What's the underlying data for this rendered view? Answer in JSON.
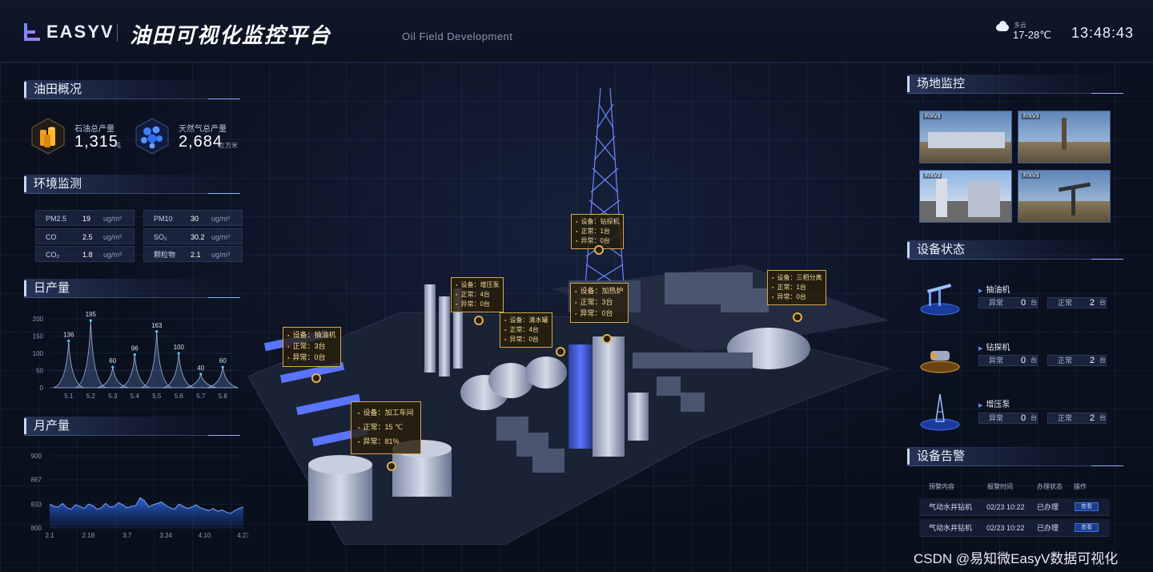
{
  "header": {
    "logo_text": "EASYV",
    "title": "油田可视化监控平台",
    "subtitle": "Oil Field Development",
    "weather_desc": "多云",
    "weather_temp": "17-28℃",
    "time": "13:48:43"
  },
  "overview": {
    "title": "油田概况",
    "oil_label": "石油总产量",
    "oil_value": "1,315",
    "oil_unit": "吨",
    "gas_label": "天然气总产量",
    "gas_value": "2,684",
    "gas_unit": "立方米"
  },
  "environment": {
    "title": "环境监测",
    "cells": [
      {
        "name": "PM2.5",
        "value": "19",
        "unit": "ug/m³"
      },
      {
        "name": "PM10",
        "value": "30",
        "unit": "ug/m³"
      },
      {
        "name": "CO",
        "value": "2.5",
        "unit": "ug/m³"
      },
      {
        "name": "SO₂",
        "value": "30.2",
        "unit": "ug/m³"
      },
      {
        "name": "CO₂",
        "value": "1.8",
        "unit": "ug/m³"
      },
      {
        "name": "颗粒物",
        "value": "2.1",
        "unit": "ug/m³"
      }
    ]
  },
  "daily": {
    "title": "日产量"
  },
  "monthly": {
    "title": "月产量"
  },
  "chart_data": [
    {
      "type": "area",
      "categories": [
        "5.1",
        "5.2",
        "5.3",
        "5.4",
        "5.5",
        "5.6",
        "5.7",
        "5.8"
      ],
      "values": [
        136,
        195,
        60,
        96,
        163,
        100,
        40,
        60
      ],
      "yticks": [
        "0",
        "50",
        "100",
        "150",
        "200"
      ],
      "ylim": [
        0,
        200
      ]
    },
    {
      "type": "area",
      "xticks": [
        "2.1",
        "2.18",
        "3.7",
        "3.24",
        "4.10",
        "4.27"
      ],
      "yticks": [
        "800",
        "833",
        "867",
        "900"
      ],
      "ylim": [
        800,
        900
      ],
      "values": [
        833,
        830,
        829,
        834,
        828,
        826,
        832,
        830,
        827,
        833,
        831,
        826,
        828,
        834,
        829,
        830,
        835,
        832,
        828,
        830,
        831,
        842,
        838,
        829,
        832,
        834,
        836,
        831,
        828,
        826,
        833,
        830,
        827,
        829,
        832,
        828,
        826,
        824,
        827,
        823,
        825,
        822,
        820,
        824,
        827,
        829
      ]
    }
  ],
  "site": {
    "title": "场地监控",
    "cameras": [
      {
        "tag": "F/XV3"
      },
      {
        "tag": "F/XV3"
      },
      {
        "tag": "F/XV3"
      },
      {
        "tag": "F/XV3"
      }
    ]
  },
  "equipment": {
    "title": "设备状态",
    "abnormal_label": "异常",
    "normal_label": "正常",
    "unit": "台",
    "items": [
      {
        "name": "抽油机",
        "abnormal": "0",
        "normal": "2"
      },
      {
        "name": "钻探机",
        "abnormal": "0",
        "normal": "2"
      },
      {
        "name": "增压泵",
        "abnormal": "0",
        "normal": "2"
      }
    ]
  },
  "alarms": {
    "title": "设备告警",
    "headers": [
      "预警内容",
      "报警时间",
      "办理状态",
      "操作"
    ],
    "rows": [
      {
        "content": "气动水井钻机",
        "time": "02/23 10:22",
        "status": "已办理",
        "action": "查看"
      },
      {
        "content": "气动水井钻机",
        "time": "02/23 10:22",
        "status": "已办理",
        "action": "查看"
      }
    ]
  },
  "scene_labels": {
    "drill": [
      "设备：钻探机",
      "正常：1台",
      "异常：0台"
    ],
    "pump": [
      "设备：增压泵",
      "正常：4台",
      "异常：0台"
    ],
    "tank": [
      "设备：清水罐",
      "正常：4台",
      "异常：0台"
    ],
    "heater": [
      "设备：加热炉",
      "正常：3台",
      "异常：0台"
    ],
    "separator": [
      "设备：三相分离",
      "正常：1台",
      "异常：0台"
    ],
    "pumpjack": [
      "设备：抽油机",
      "正常：3台",
      "异常：0台"
    ],
    "workshop": [
      "设备：加工车间",
      "正常：15 ℃",
      "异常：81%"
    ]
  },
  "watermark": "CSDN @易知微EasyV数据可视化"
}
